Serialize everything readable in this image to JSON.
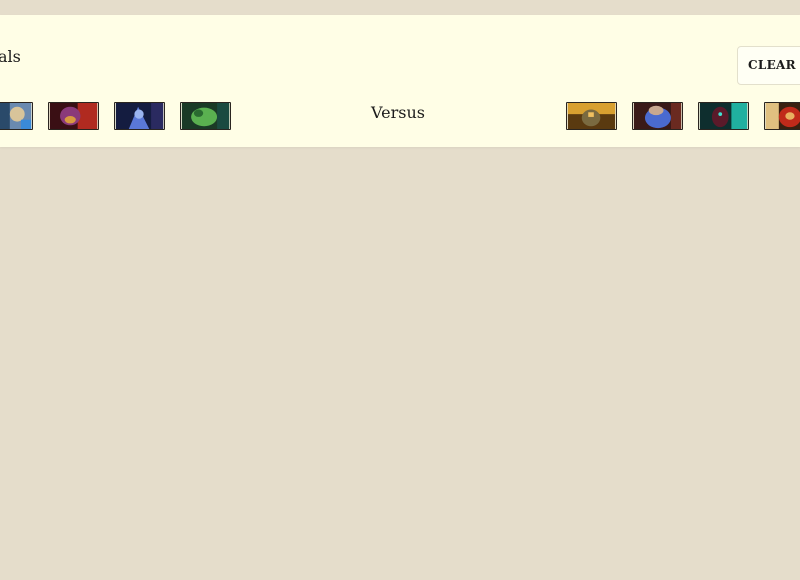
{
  "panel": {
    "title": "als",
    "clear_label": "CLEAR S",
    "versus_label": "Versus"
  },
  "radiant_heroes": [
    {
      "icon": "hero-portrait-light-armor-icon",
      "bg": "#2a4a6a",
      "accent": "#d8c49a"
    },
    {
      "icon": "hero-portrait-demon-red-icon",
      "bg": "#3a0f14",
      "accent": "#8a3a7a"
    },
    {
      "icon": "hero-portrait-blue-mage-icon",
      "bg": "#141c40",
      "accent": "#5a78d8"
    },
    {
      "icon": "hero-portrait-green-beast-icon",
      "bg": "#1a3a26",
      "accent": "#5ab050"
    }
  ],
  "dire_heroes": [
    {
      "icon": "hero-portrait-gold-warrior-icon",
      "bg": "#5a3a10",
      "accent": "#d8a030"
    },
    {
      "icon": "hero-portrait-blue-brute-icon",
      "bg": "#3a1a18",
      "accent": "#4a6ad0"
    },
    {
      "icon": "hero-portrait-teal-assassin-icon",
      "bg": "#0e2e2e",
      "accent": "#20b0a0"
    },
    {
      "icon": "hero-portrait-red-warrior-icon",
      "bg": "#3a2010",
      "accent": "#c02a1a"
    }
  ]
}
